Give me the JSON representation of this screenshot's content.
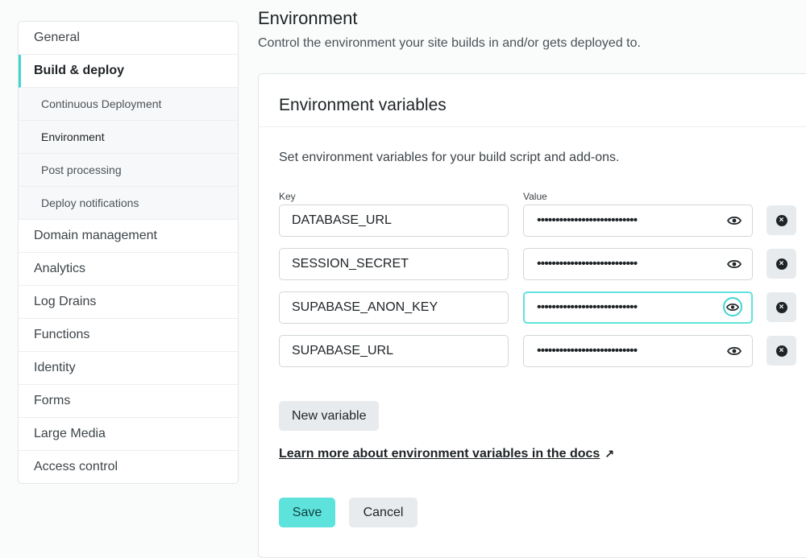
{
  "sidebar": {
    "items": [
      {
        "label": "General"
      },
      {
        "label": "Build & deploy"
      },
      {
        "label": "Domain management"
      },
      {
        "label": "Analytics"
      },
      {
        "label": "Log Drains"
      },
      {
        "label": "Functions"
      },
      {
        "label": "Identity"
      },
      {
        "label": "Forms"
      },
      {
        "label": "Large Media"
      },
      {
        "label": "Access control"
      }
    ],
    "subitems": [
      {
        "label": "Continuous Deployment"
      },
      {
        "label": "Environment"
      },
      {
        "label": "Post processing"
      },
      {
        "label": "Deploy notifications"
      }
    ]
  },
  "header": {
    "title": "Environment",
    "description": "Control the environment your site builds in and/or gets deployed to."
  },
  "card": {
    "title": "Environment variables",
    "description": "Set environment variables for your build script and add-ons.",
    "key_label": "Key",
    "value_label": "Value",
    "variables": [
      {
        "key": "DATABASE_URL",
        "value": "•••••••••••••••••••••••••••"
      },
      {
        "key": "SESSION_SECRET",
        "value": "•••••••••••••••••••••••••••"
      },
      {
        "key": "SUPABASE_ANON_KEY",
        "value": "•••••••••••••••••••••••••••"
      },
      {
        "key": "SUPABASE_URL",
        "value": "•••••••••••••••••••••••••••"
      }
    ],
    "new_variable_label": "New variable",
    "docs_link": "Learn more about environment variables in the docs",
    "docs_arrow": "↗",
    "save_label": "Save",
    "cancel_label": "Cancel"
  },
  "colors": {
    "accent": "#5ee3dc",
    "active_border": "#3fd6d0"
  },
  "icons": {
    "reveal": "eye-icon",
    "remove": "x-circle-icon",
    "external": "arrow-up-right-icon"
  }
}
